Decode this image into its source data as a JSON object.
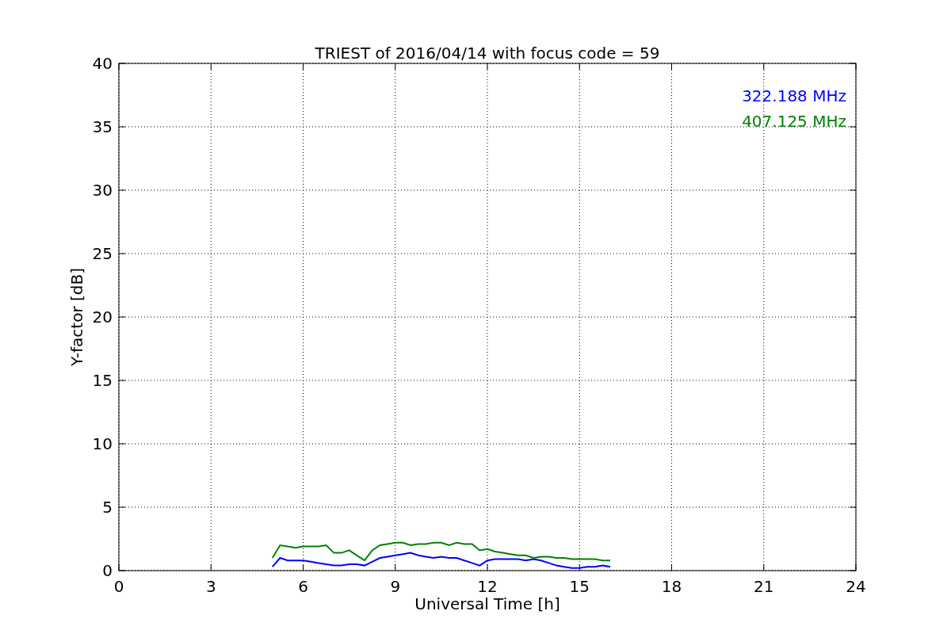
{
  "chart_data": {
    "type": "line",
    "title": "TRIEST of 2016/04/14 with focus code = 59",
    "xlabel": "Universal Time [h]",
    "ylabel": "Y-factor [dB]",
    "x": [
      5.0,
      5.25,
      5.5,
      5.75,
      6.0,
      6.25,
      6.5,
      6.75,
      7.0,
      7.25,
      7.5,
      7.75,
      8.0,
      8.25,
      8.5,
      8.75,
      9.0,
      9.25,
      9.5,
      9.75,
      10.0,
      10.25,
      10.5,
      10.75,
      11.0,
      11.25,
      11.5,
      11.75,
      12.0,
      12.25,
      12.5,
      12.75,
      13.0,
      13.25,
      13.5,
      13.75,
      14.0,
      14.25,
      14.5,
      14.75,
      15.0,
      15.25,
      15.5,
      15.75,
      16.0
    ],
    "series": [
      {
        "name": "322.188 MHz",
        "color": "#0000ff",
        "values": [
          0.3,
          1.0,
          0.8,
          0.8,
          0.8,
          0.7,
          0.6,
          0.5,
          0.4,
          0.4,
          0.5,
          0.5,
          0.4,
          0.7,
          1.0,
          1.1,
          1.2,
          1.3,
          1.4,
          1.2,
          1.1,
          1.0,
          1.1,
          1.0,
          1.0,
          0.8,
          0.6,
          0.4,
          0.8,
          0.9,
          0.9,
          0.9,
          0.9,
          0.8,
          0.9,
          0.8,
          0.6,
          0.4,
          0.3,
          0.2,
          0.2,
          0.3,
          0.3,
          0.4,
          0.3
        ]
      },
      {
        "name": "407.125 MHz",
        "color": "#008000",
        "values": [
          1.0,
          2.0,
          1.9,
          1.8,
          1.9,
          1.9,
          1.9,
          2.0,
          1.4,
          1.4,
          1.6,
          1.2,
          0.8,
          1.6,
          2.0,
          2.1,
          2.2,
          2.2,
          2.0,
          2.1,
          2.1,
          2.2,
          2.2,
          2.0,
          2.2,
          2.1,
          2.1,
          1.6,
          1.7,
          1.5,
          1.4,
          1.3,
          1.2,
          1.2,
          1.0,
          1.1,
          1.1,
          1.0,
          1.0,
          0.9,
          0.9,
          0.9,
          0.9,
          0.8,
          0.8
        ]
      }
    ],
    "xlim": [
      0,
      24
    ],
    "ylim": [
      0,
      40
    ],
    "xticks": [
      0,
      3,
      6,
      9,
      12,
      15,
      18,
      21,
      24
    ],
    "yticks": [
      0,
      5,
      10,
      15,
      20,
      25,
      30,
      35,
      40
    ],
    "grid": true
  }
}
